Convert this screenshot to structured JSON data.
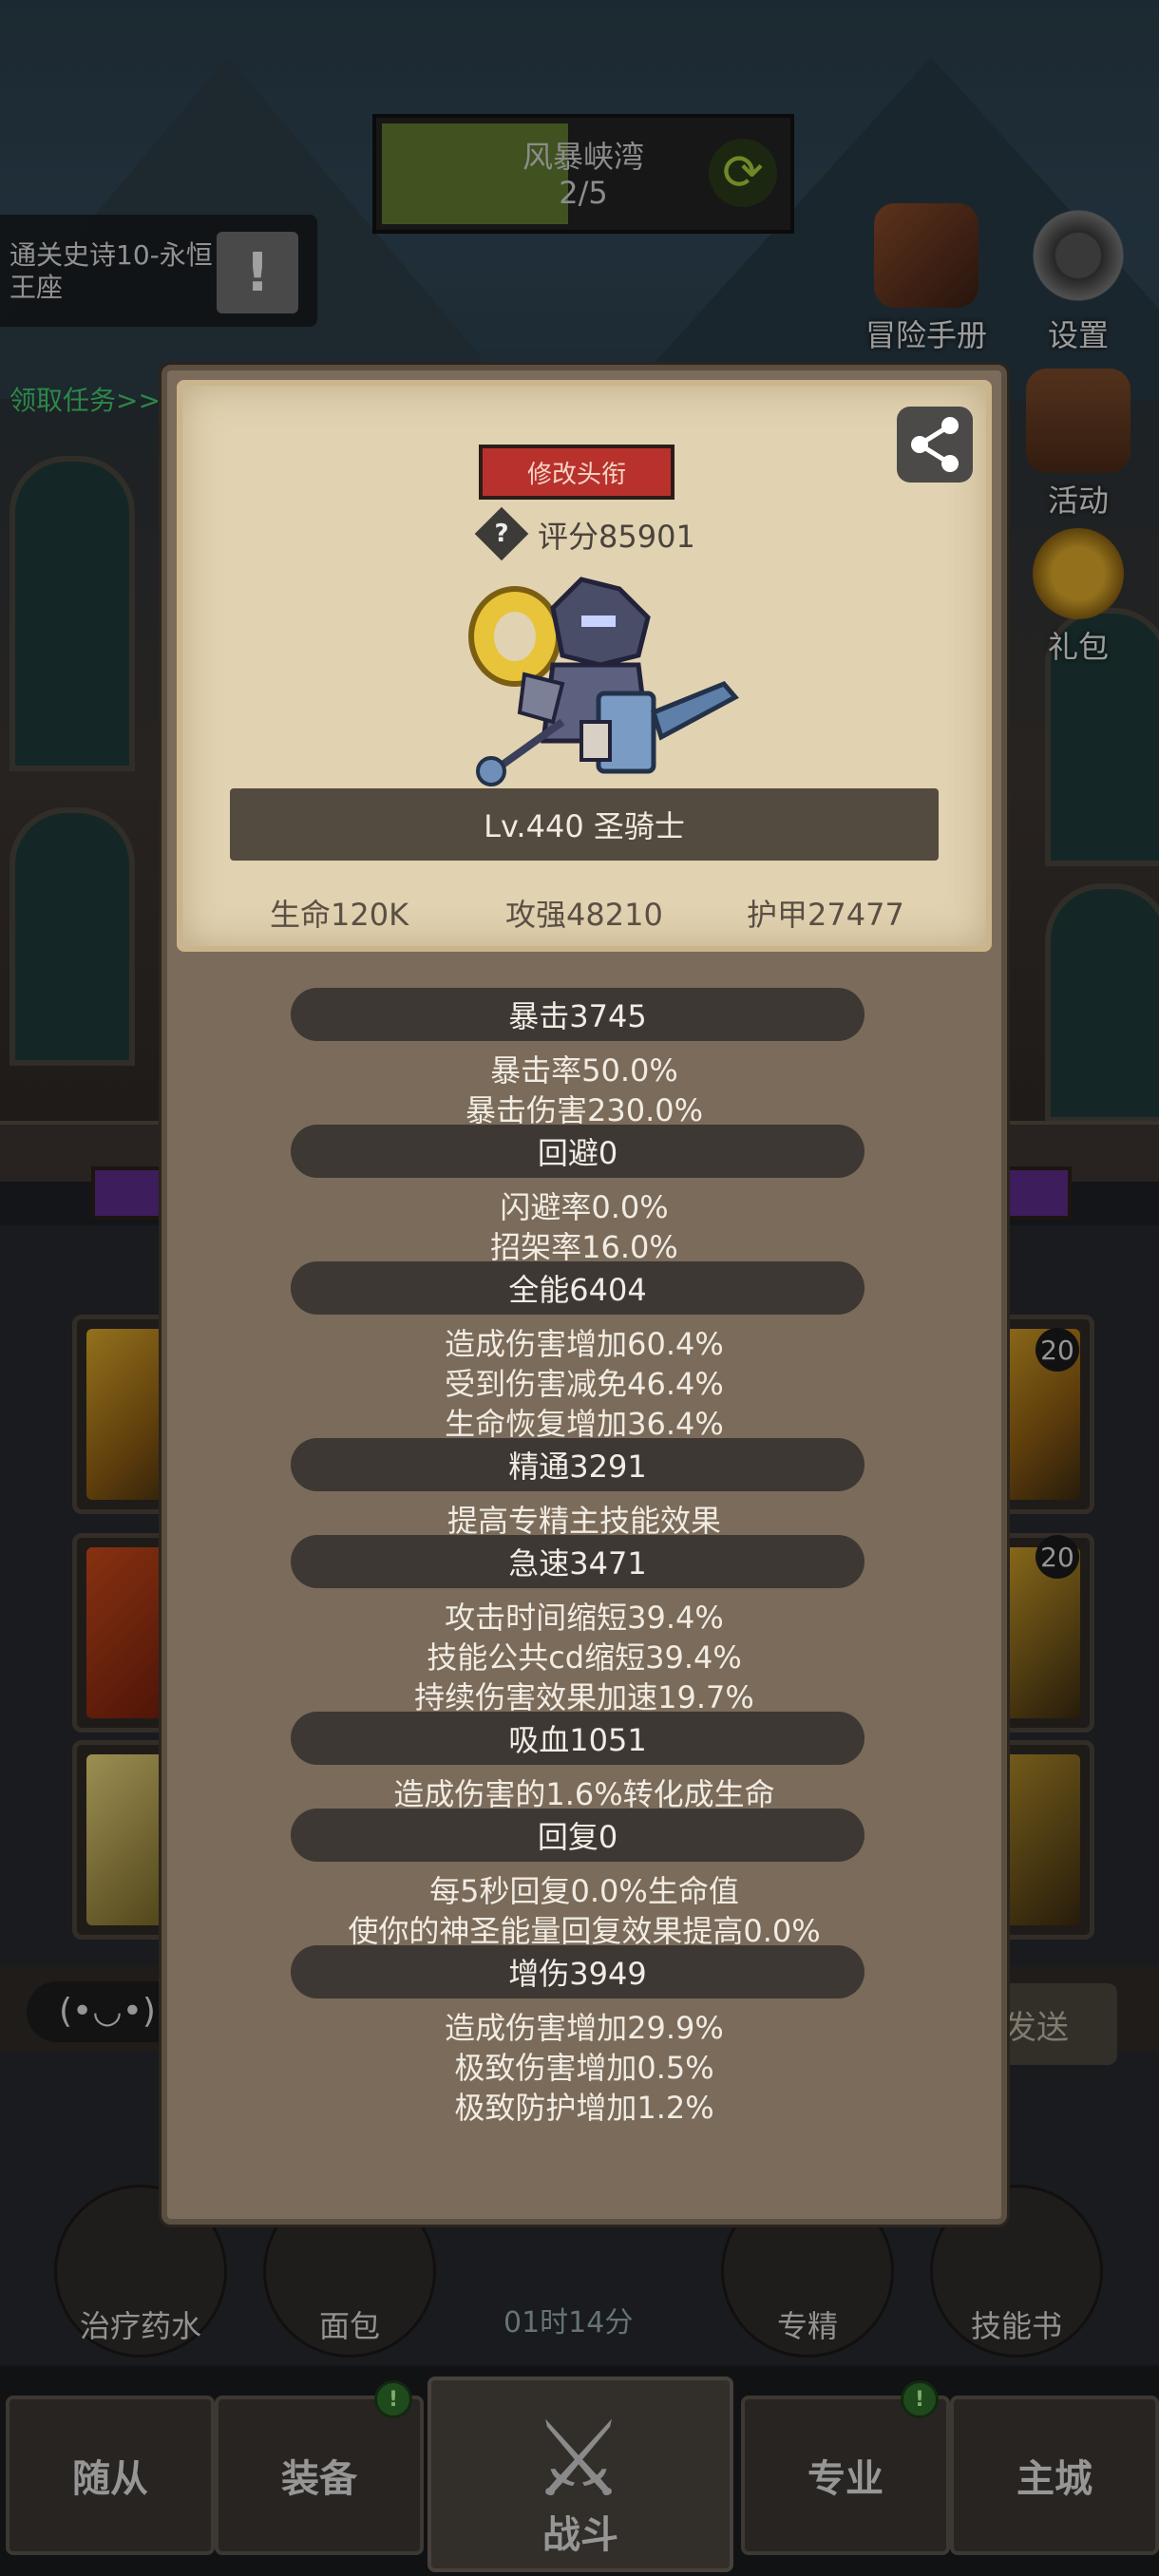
{
  "stage": {
    "name": "风暴峡湾",
    "progress": "2/5"
  },
  "quest": {
    "title": "通关史诗10-永恒王座",
    "icon_text": "!",
    "claim_link": "领取任务>>"
  },
  "side_menu": [
    {
      "label": "冒险手册",
      "icon": "book-icon"
    },
    {
      "label": "设置",
      "icon": "gear-icon"
    },
    {
      "label": "活动",
      "icon": "calendar-icon"
    },
    {
      "label": "礼包",
      "icon": "gift-icon"
    }
  ],
  "chat": {
    "emote": "(•◡•)",
    "send_label": "发送"
  },
  "consumables": [
    {
      "label": "治疗药水"
    },
    {
      "label": "面包"
    },
    {
      "label": "专精"
    },
    {
      "label": "技能书"
    }
  ],
  "timer": "01时14分",
  "slot_badges": [
    "20",
    "20"
  ],
  "bottom_nav": [
    {
      "label": "随从",
      "dot": false
    },
    {
      "label": "装备",
      "dot": true
    },
    {
      "label": "战斗",
      "dot": false
    },
    {
      "label": "专业",
      "dot": true
    },
    {
      "label": "主城",
      "dot": false
    }
  ],
  "popup": {
    "title_button": "修改头衔",
    "help_icon": "?",
    "score": "评分85901",
    "level_line": "Lv.440 圣骑士",
    "core_stats": [
      "生命120K",
      "攻强48210",
      "护甲27477"
    ],
    "stats": [
      {
        "header": "暴击3745",
        "lines": [
          "暴击率50.0%",
          "暴击伤害230.0%"
        ]
      },
      {
        "header": "回避0",
        "lines": [
          "闪避率0.0%",
          "招架率16.0%"
        ]
      },
      {
        "header": "全能6404",
        "lines": [
          "造成伤害增加60.4%",
          "受到伤害减免46.4%",
          "生命恢复增加36.4%"
        ]
      },
      {
        "header": "精通3291",
        "lines": [
          "提高专精主技能效果"
        ]
      },
      {
        "header": "急速3471",
        "lines": [
          "攻击时间缩短39.4%",
          "技能公共cd缩短39.4%",
          "持续伤害效果加速19.7%"
        ]
      },
      {
        "header": "吸血1051",
        "lines": [
          "造成伤害的1.6%转化成生命"
        ]
      },
      {
        "header": "回复0",
        "lines": [
          "每5秒回复0.0%生命值",
          "使你的神圣能量回复效果提高0.0%"
        ]
      },
      {
        "header": "增伤3949",
        "lines": [
          "造成伤害增加29.9%",
          "极致伤害增加0.5%",
          "极致防护增加1.2%"
        ]
      }
    ]
  },
  "colors": {
    "title_button": "#b8312d",
    "stat_header": "#3d3833",
    "popup_bg": "#7b6b5a",
    "card_bg": "#e1d2b1",
    "claim_link": "#41c86a"
  }
}
